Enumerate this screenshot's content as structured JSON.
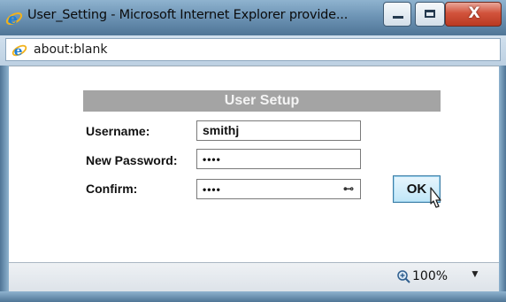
{
  "window": {
    "title": "User_Setting - Microsoft Internet Explorer provide...",
    "minimize_icon": "minimize-icon",
    "maximize_icon": "maximize-icon",
    "close_glyph": "X"
  },
  "address_bar": {
    "url": "about:blank",
    "icon": "ie-logo-icon"
  },
  "form": {
    "header": "User Setup",
    "username_label": "Username:",
    "username_value": "smithj",
    "new_password_label": "New Password:",
    "new_password_value": "••••",
    "confirm_label": "Confirm:",
    "confirm_value": "••••",
    "confirm_reveal_glyph": "⊷",
    "ok_label": "OK"
  },
  "status_bar": {
    "zoom_level": "100%",
    "zoom_dropdown_glyph": "▼"
  },
  "colors": {
    "titlebar": "#6e95b6",
    "close_button": "#d2533c",
    "header_bg": "#a4a4a4",
    "ok_button": "#bfe6f8"
  }
}
